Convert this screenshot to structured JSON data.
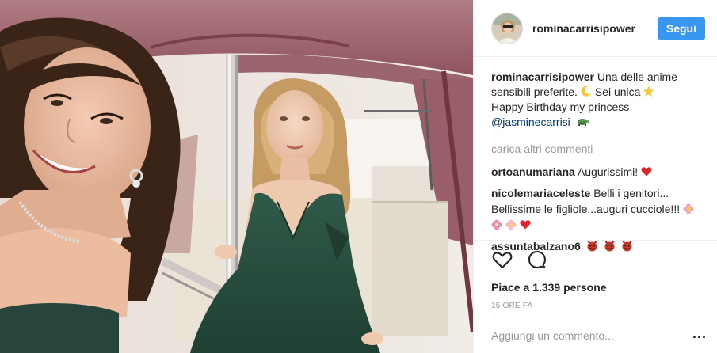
{
  "header": {
    "username": "rominacarrisipower",
    "follow_label": "Segui"
  },
  "caption": {
    "username": "rominacarrisipower",
    "line1": "Una delle anime",
    "line2a": "sensibili preferite.",
    "line2b": " Sei unica",
    "line3": "Happy Birthday my princess",
    "mention": "@jasminecarrisi"
  },
  "load_more_label": "carica altri commenti",
  "comments": [
    {
      "user": "ortoanumariana",
      "text": "Augurissimi!"
    },
    {
      "user": "nicolemariaceleste",
      "text1": "Belli i genitori...",
      "text2": "Bellissime le figliole...auguri cucciole!!!"
    },
    {
      "user": "assuntabalzano6",
      "text": ""
    }
  ],
  "likes_text": "Piace a 1.339 persone",
  "time_text": "15 ORE FA",
  "add_comment_placeholder": "Aggiungi un commento...",
  "more_label": "...",
  "icons": {
    "like": "heart-outline-icon",
    "comment": "speech-bubble-icon",
    "moon": "crescent-moon-emoji",
    "star": "star-emoji",
    "turtle": "turtle-emoji",
    "heart": "red-heart-emoji",
    "flower": "blossom-emoji",
    "face": "devil-face-emoji"
  },
  "colors": {
    "accent": "#3897f0",
    "muted": "#999999",
    "text": "#262626",
    "mention": "#003569",
    "border": "#efefef"
  }
}
